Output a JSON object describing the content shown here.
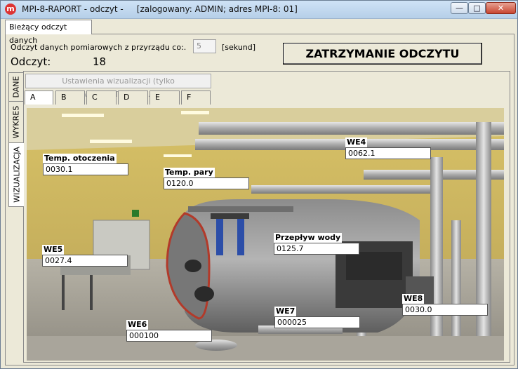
{
  "window": {
    "title": "MPI-8-RAPORT - odczyt -     [zalogowany: ADMIN; adres MPI-8: 01]",
    "app_icon": "m",
    "controls": {
      "minimize": "—",
      "maximize": "□",
      "close": "✕"
    }
  },
  "top_tab": {
    "label": "Bieżący odczyt danych"
  },
  "reading": {
    "interval_label": "Odczyt danych pomiarowych z przyrządu co:.",
    "interval_value": "5",
    "interval_unit": "[sekund]",
    "stop_button": "ZATRZYMANIE ODCZYTU",
    "count_label": "Odczyt:",
    "count_value": "18"
  },
  "side_tabs": [
    "DANE",
    "WYKRES",
    "WIZUALIZACJA"
  ],
  "side_tab_active": "WIZUALIZACJA",
  "visualization": {
    "settings_button": "Ustawienia wizualizacji (tylko ADMINISTRATOR)...",
    "subtabs": [
      "A",
      "B",
      "C",
      "D",
      "E",
      "F"
    ],
    "subtab_active": "A"
  },
  "sensors": [
    {
      "name": "Temp. otoczenia",
      "value": "0030.1"
    },
    {
      "name": "Temp. pary",
      "value": "0120.0"
    },
    {
      "name": "WE4",
      "value": "0062.1"
    },
    {
      "name": "WE5",
      "value": "0027.4"
    },
    {
      "name": "Przepływ wody",
      "value": "0125.7"
    },
    {
      "name": "WE8",
      "value": "0030.0"
    },
    {
      "name": "WE7",
      "value": "000025"
    },
    {
      "name": "WE6",
      "value": "000100"
    }
  ]
}
